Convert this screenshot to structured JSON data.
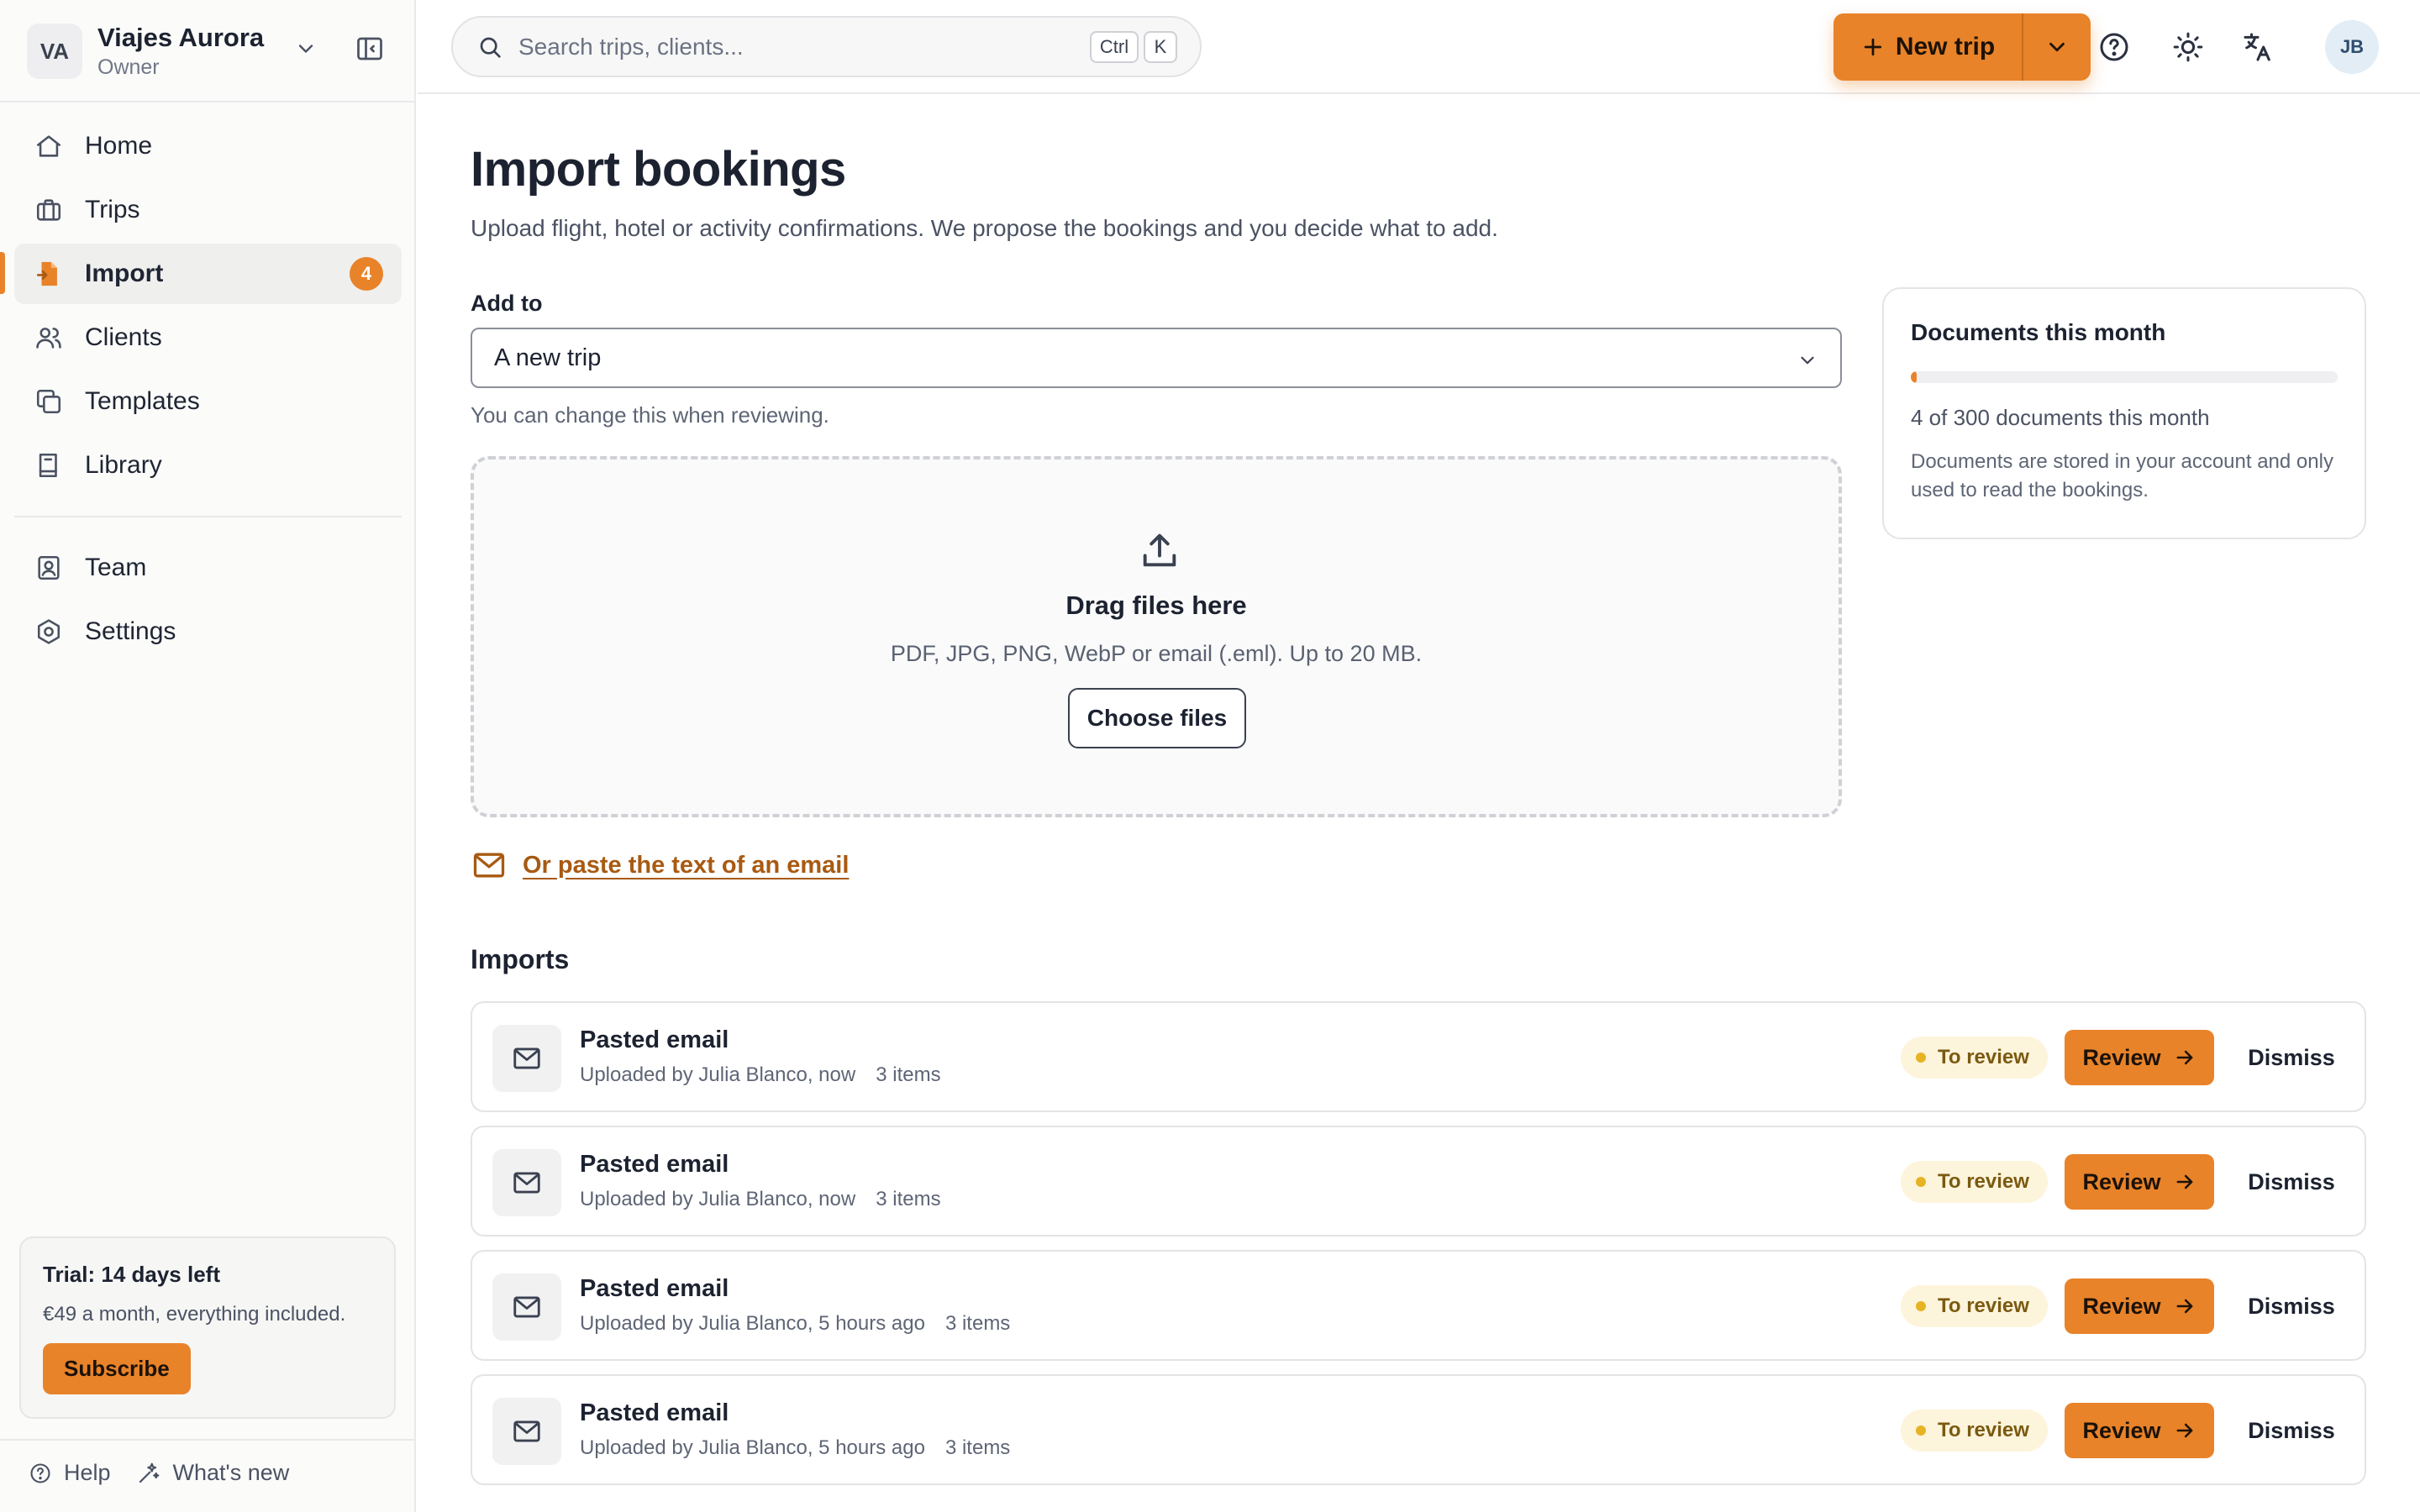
{
  "workspace": {
    "initials": "VA",
    "name": "Viajes Aurora",
    "role": "Owner"
  },
  "sidebar": {
    "items": [
      {
        "label": "Home",
        "icon": "home-icon"
      },
      {
        "label": "Trips",
        "icon": "briefcase-icon"
      },
      {
        "label": "Import",
        "icon": "import-file-icon",
        "badge": "4",
        "active": true
      },
      {
        "label": "Clients",
        "icon": "users-icon"
      },
      {
        "label": "Templates",
        "icon": "copy-icon"
      },
      {
        "label": "Library",
        "icon": "book-icon"
      },
      {
        "label": "Team",
        "icon": "contact-card-icon"
      },
      {
        "label": "Settings",
        "icon": "gear-icon"
      }
    ],
    "trial": {
      "title": "Trial: 14 days left",
      "text": "€49 a month, everything included.",
      "button": "Subscribe"
    },
    "footer": {
      "help": "Help",
      "whats_new": "What's new"
    }
  },
  "topbar": {
    "search_placeholder": "Search trips, clients...",
    "shortcut": [
      "Ctrl",
      "K"
    ],
    "new_trip": "New trip",
    "user_initials": "JB"
  },
  "main": {
    "title": "Import bookings",
    "subtitle": "Upload flight, hotel or activity confirmations. We propose the bookings and you decide what to add.",
    "add_to_label": "Add to",
    "add_to_value": "A new trip",
    "add_to_hint": "You can change this when reviewing.",
    "dropzone": {
      "title": "Drag files here",
      "subtitle": "PDF, JPG, PNG, WebP or email (.eml). Up to 20 MB.",
      "button": "Choose files"
    },
    "paste_link": "Or paste the text of an email",
    "imports_title": "Imports",
    "imports": [
      {
        "title": "Pasted email",
        "meta": "Uploaded by Julia Blanco, now",
        "count": "3 items",
        "status": "To review",
        "review": "Review",
        "dismiss": "Dismiss"
      },
      {
        "title": "Pasted email",
        "meta": "Uploaded by Julia Blanco, now",
        "count": "3 items",
        "status": "To review",
        "review": "Review",
        "dismiss": "Dismiss"
      },
      {
        "title": "Pasted email",
        "meta": "Uploaded by Julia Blanco, 5 hours ago",
        "count": "3 items",
        "status": "To review",
        "review": "Review",
        "dismiss": "Dismiss"
      },
      {
        "title": "Pasted email",
        "meta": "Uploaded by Julia Blanco, 5 hours ago",
        "count": "3 items",
        "status": "To review",
        "review": "Review",
        "dismiss": "Dismiss"
      }
    ]
  },
  "docs": {
    "title": "Documents this month",
    "used": 4,
    "limit": 300,
    "count_text": "4 of 300 documents this month",
    "note": "Documents are stored in your account and only used to read the bookings."
  },
  "colors": {
    "accent": "#e8832a",
    "pill_bg": "#fdf4dc",
    "pill_dot": "#e6b422",
    "link": "#a85a12"
  }
}
